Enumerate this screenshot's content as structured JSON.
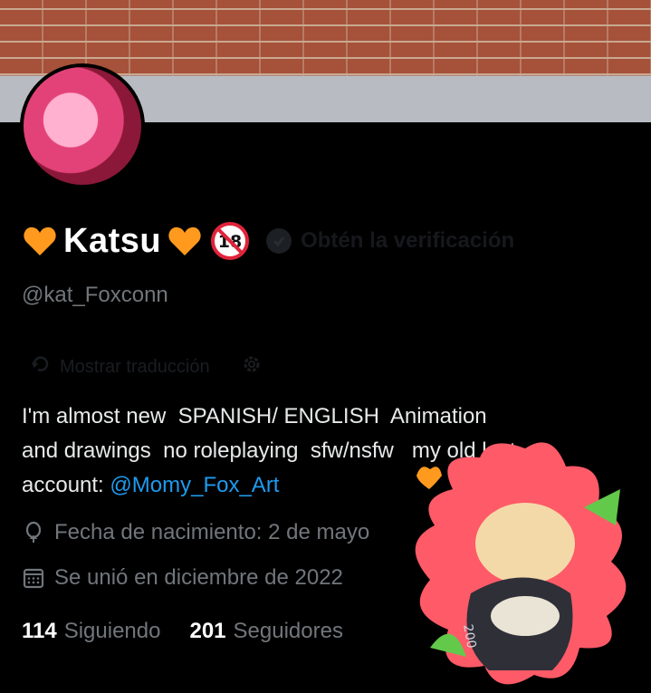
{
  "profile": {
    "display_name": "Katsu",
    "handle": "@kat_Foxconn",
    "age_badge": "18",
    "verify_label": "Obtén la verificación",
    "translate_label": "Mostrar traducción",
    "bio_text": "I'm almost new  SPANISH/ ENGLISH  Animation\nand drawings  no roleplaying  sfw/nsfw   my old lost\naccount: ",
    "bio_mention": "@Momy_Fox_Art",
    "birthday": "Fecha de nacimiento: 2 de mayo",
    "joined": "Se unió en diciembre de 2022",
    "following_count": "114",
    "following_label": "Siguiendo",
    "followers_count": "201",
    "followers_label": "Seguidores"
  },
  "colors": {
    "background": "#000000",
    "text_primary": "#e7e9ea",
    "text_secondary": "#71767b",
    "link": "#1d9bf0",
    "heart": "#ff9a1f"
  },
  "icons": {
    "heart": "orange-heart-icon",
    "age": "no-under-18-icon",
    "verify": "verified-badge-icon",
    "translate": "translate-icon",
    "settings": "gear-icon",
    "birthday": "balloon-icon",
    "joined": "calendar-icon"
  },
  "sticker": {
    "text": "200"
  }
}
